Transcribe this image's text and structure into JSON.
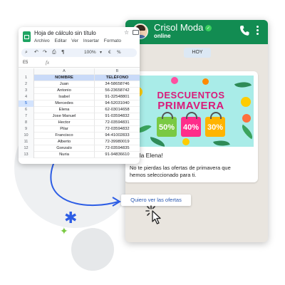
{
  "spreadsheet": {
    "title": "Hoja de cálculo sin título",
    "menu": [
      "Archivo",
      "Editar",
      "Ver",
      "Insertar",
      "Formato"
    ],
    "zoom": "100%",
    "cell_ref": "E5",
    "fx": "fx",
    "columns": [
      "A",
      "B"
    ],
    "header": {
      "row_num": "1",
      "name": "NOMBRE",
      "phone": "TELÉFONO"
    },
    "rows": [
      {
        "n": "2",
        "name": "Juan",
        "phone": "34-58658746"
      },
      {
        "n": "3",
        "name": "Antonio",
        "phone": "56-23658742"
      },
      {
        "n": "4",
        "name": "Isabel",
        "phone": "91-32548801"
      },
      {
        "n": "5",
        "name": "Mercedes",
        "phone": "94-52031040"
      },
      {
        "n": "6",
        "name": "Elena",
        "phone": "62-03014658"
      },
      {
        "n": "7",
        "name": "Jose Manuel",
        "phone": "91-03594832"
      },
      {
        "n": "8",
        "name": "Hector",
        "phone": "72-03594831"
      },
      {
        "n": "9",
        "name": "Pilar",
        "phone": "72-03594832"
      },
      {
        "n": "10",
        "name": "Francisco",
        "phone": "94-41002833"
      },
      {
        "n": "11",
        "name": "Alberto",
        "phone": "72-39980019"
      },
      {
        "n": "12",
        "name": "Gonzalo",
        "phone": "72-03594835"
      },
      {
        "n": "13",
        "name": "Nuria",
        "phone": "91-94836610"
      }
    ]
  },
  "chat": {
    "contact_name": "Crisol Moda",
    "contact_status": "online",
    "date_chip": "HOY",
    "banner": {
      "title": "DESCUENTOS",
      "subtitle": "PRIMAVERA",
      "discounts": [
        "50%",
        "40%",
        "30%"
      ]
    },
    "greeting": "¡Hola Elena!",
    "body": "No te pierdas las ofertas de primavera que hemos seleccionado para ti.",
    "cta_label": "Quiero ver las ofertas",
    "colors": {
      "header": "#128c52",
      "background": "#e9e5df",
      "banner_text": "#d91b7a"
    }
  },
  "icons": [
    "sheets-logo-icon",
    "star-icon",
    "folder-icon",
    "search-icon",
    "undo-icon",
    "redo-icon",
    "print-icon",
    "paint-format-icon",
    "avatar",
    "verified-icon",
    "phone-icon",
    "menu-dots-icon",
    "click-cursor-icon"
  ]
}
